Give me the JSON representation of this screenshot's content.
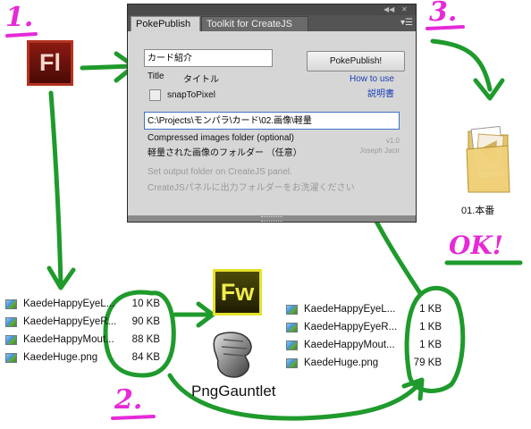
{
  "panel": {
    "tabs": [
      "PokePublish",
      "Toolkit for CreateJS"
    ],
    "topbar_icons": [
      "collapse-icon",
      "close-icon"
    ],
    "title_value": "カード紹介",
    "title_label": "Title",
    "title_label_jp": "タイトル",
    "snap_label": "snapToPixel",
    "publish_button": "PokePublish!",
    "howto_en": "How to use",
    "howto_jp": "説明書",
    "path_value": "C:\\Projects\\モンパラ\\カード\\02.画像\\軽量",
    "compressed_label": "Compressed images folder (optional)",
    "compressed_label_jp": "軽量された画像のフォルダー （任意）",
    "version": "v1.0",
    "author": "Joseph Jacir",
    "note_en": "Set output folder on CreateJS panel.",
    "note_jp": "CreateJSパネルに出力フォルダーをお洗濯ください"
  },
  "apps": {
    "flash": "Fl",
    "fireworks": "Fw",
    "gauntlet": "PngGauntlet"
  },
  "steps": [
    "1.",
    "2.",
    "3."
  ],
  "ok_text": "OK!",
  "folder_label": "01.本番",
  "left_files": [
    {
      "name": "KaedeHappyEyeL...",
      "size": "10 KB"
    },
    {
      "name": "KaedeHappyEyeR...",
      "size": "90 KB"
    },
    {
      "name": "KaedeHappyMout...",
      "size": "88 KB"
    },
    {
      "name": "KaedeHuge.png",
      "size": "84 KB"
    }
  ],
  "right_files": [
    {
      "name": "KaedeHappyEyeL...",
      "size": "1 KB"
    },
    {
      "name": "KaedeHappyEyeR...",
      "size": "1 KB"
    },
    {
      "name": "KaedeHappyMout...",
      "size": "1 KB"
    },
    {
      "name": "KaedeHuge.png",
      "size": "79 KB"
    }
  ],
  "colors": {
    "annotation_green": "#1f9a2c",
    "annotation_magenta": "#e62ad8",
    "link_blue": "#1a3fb5"
  }
}
